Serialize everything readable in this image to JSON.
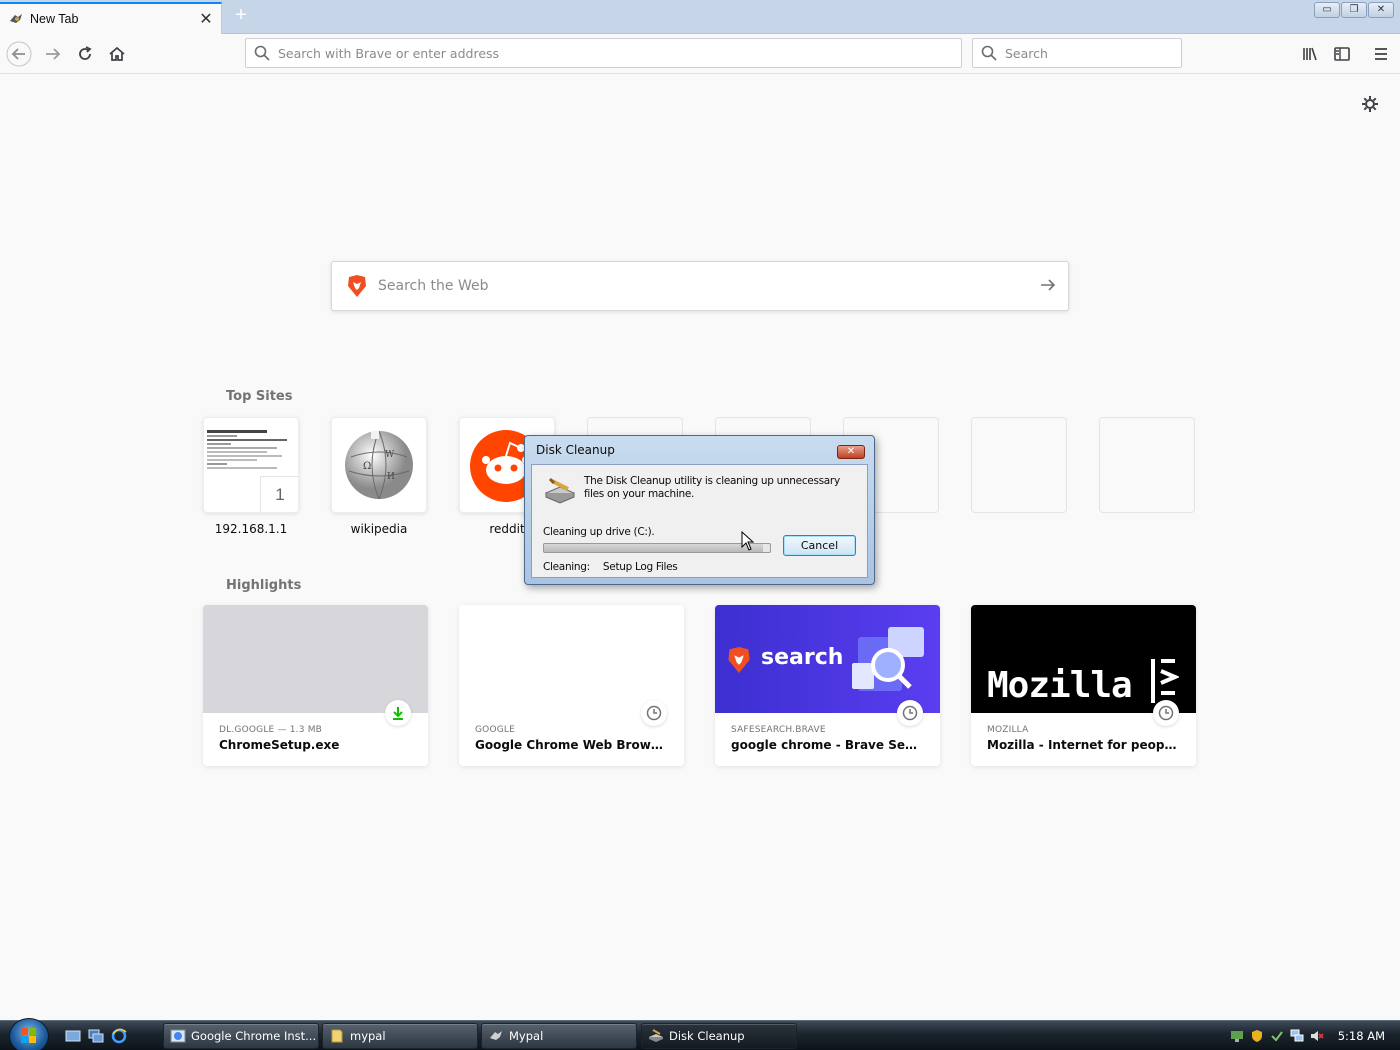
{
  "browser": {
    "tab_title": "New Tab",
    "new_tab_symbol": "+",
    "url_placeholder": "Search with Brave or enter address",
    "search_placeholder": "Search"
  },
  "newtab": {
    "search_placeholder": "Search the Web",
    "top_sites_heading": "Top Sites",
    "highlights_heading": "Highlights",
    "top_sites": [
      {
        "label": "192.168.1.1",
        "badge": "1"
      },
      {
        "label": "wikipedia"
      },
      {
        "label": "reddit"
      }
    ],
    "highlights": [
      {
        "context": "DL.GOOGLE — 1.3 MB",
        "title": "ChromeSetup.exe",
        "badge_icon": "download-icon"
      },
      {
        "context": "GOOGLE",
        "title": "Google Chrome Web Browser",
        "badge_icon": "clock-icon"
      },
      {
        "context": "SAFESEARCH.BRAVE",
        "title": "google chrome - Brave Search",
        "badge_icon": "clock-icon",
        "thumb_text": "search"
      },
      {
        "context": "MOZILLA",
        "title": "Mozilla - Internet for people, no...",
        "badge_icon": "clock-icon",
        "thumb_text": "Mozilla"
      }
    ],
    "colors": {
      "brave_search_bg": "#4436d9",
      "mozilla_bg": "#000000",
      "reddit": "#ff4500",
      "brave_orange": "#f04e23"
    }
  },
  "dialog": {
    "title": "Disk Cleanup",
    "message": "The Disk Cleanup utility is cleaning up unnecessary files on your machine.",
    "drive_text": "Cleaning up drive  (C:).",
    "cancel_label": "Cancel",
    "cleaning_label": "Cleaning:",
    "cleaning_item": "Setup Log Files",
    "progress": 0.97
  },
  "taskbar": {
    "tasks": [
      {
        "label": "Google Chrome Inst..."
      },
      {
        "label": "mypal"
      },
      {
        "label": "Mypal"
      },
      {
        "label": "Disk Cleanup"
      }
    ],
    "clock": "5:18 AM"
  }
}
